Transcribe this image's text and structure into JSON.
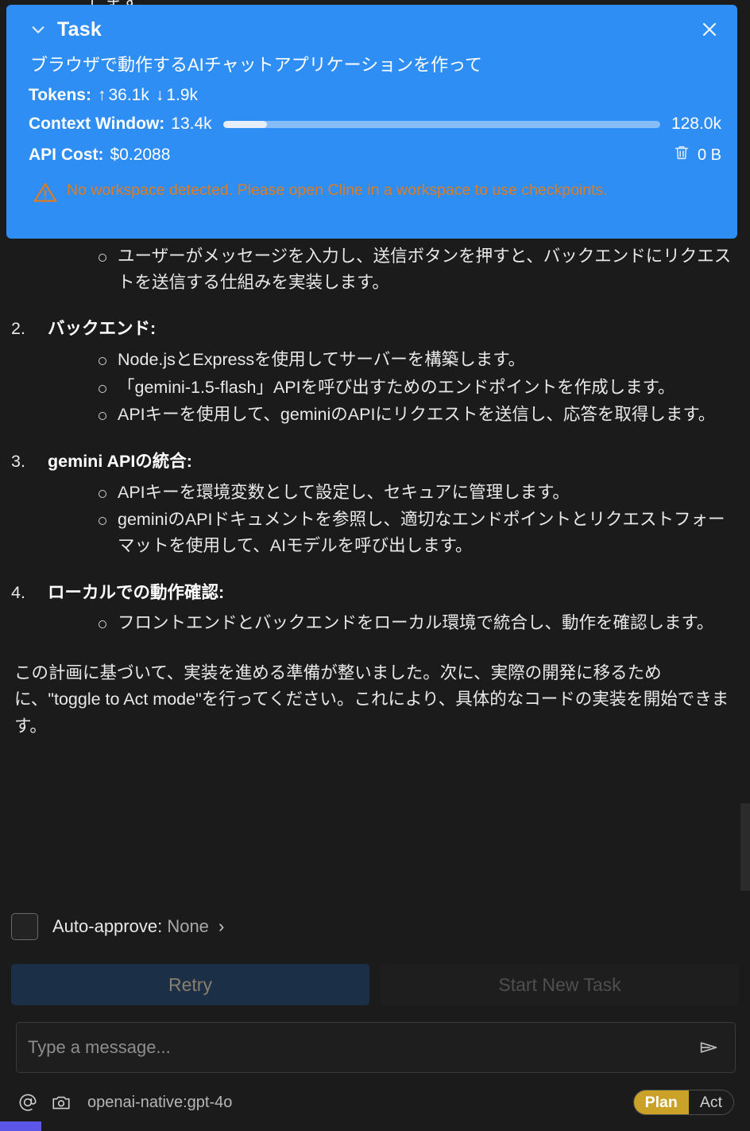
{
  "task_panel": {
    "title": "Task",
    "collapse_icon": "chevron-down-icon",
    "close_icon": "close-icon",
    "description": "ブラウザで動作するAIチャットアプリケーションを作って",
    "tokens_label": "Tokens:",
    "tokens_up_arrow": "↑",
    "tokens_up": "36.1k",
    "tokens_down_arrow": "↓",
    "tokens_down": "1.9k",
    "context_label": "Context Window:",
    "context_used": "13.4k",
    "context_max": "128.0k",
    "context_fill_percent": 10,
    "cost_label": "API Cost:",
    "cost_value": "$0.2088",
    "delete_icon": "trash-icon",
    "size_value": "0 B",
    "warning_icon": "warning-triangle-icon",
    "warning_text": "No workspace detected. Please open Cline in a workspace to use checkpoints.",
    "accent_bg": "#2f8ef4",
    "warning_color": "#de7c22"
  },
  "conversation": {
    "clipped_line": "します。",
    "items": [
      {
        "type": "bullet",
        "text": "ユーザーがメッセージを入力し、送信ボタンを押すと、バックエンドにリクエストを送信する仕組みを実装します。"
      },
      {
        "type": "numbered",
        "number": "2.",
        "heading": "バックエンド:",
        "bullets": [
          "Node.jsとExpressを使用してサーバーを構築します。",
          "「gemini-1.5-flash」APIを呼び出すためのエンドポイントを作成します。",
          "APIキーを使用して、geminiのAPIにリクエストを送信し、応答を取得します。"
        ]
      },
      {
        "type": "numbered",
        "number": "3.",
        "heading": "gemini APIの統合:",
        "bullets": [
          "APIキーを環境変数として設定し、セキュアに管理します。",
          "geminiのAPIドキュメントを参照し、適切なエンドポイントとリクエストフォーマットを使用して、AIモデルを呼び出します。"
        ]
      },
      {
        "type": "numbered",
        "number": "4.",
        "heading": "ローカルでの動作確認:",
        "bullets": [
          "フロントエンドとバックエンドをローカル環境で統合し、動作を確認します。"
        ]
      }
    ],
    "closing_paragraph": "この計画に基づいて、実装を進める準備が整いました。次に、実際の開発に移るために、\"toggle to Act mode\"を行ってください。これにより、具体的なコードの実装を開始できます。"
  },
  "auto_approve": {
    "label": "Auto-approve:",
    "value": "None",
    "chevron": "›",
    "checked": false
  },
  "buttons": {
    "retry": "Retry",
    "start_new_task": "Start New Task",
    "retry_bg": "#1b3047"
  },
  "message_input": {
    "placeholder": "Type a message...",
    "value": "",
    "send_icon": "send-icon"
  },
  "bottom_bar": {
    "mention_icon": "at-sign-icon",
    "camera_icon": "camera-icon",
    "model": "openai-native:gpt-4o",
    "mode_plan": "Plan",
    "mode_act": "Act",
    "active_mode": "Plan",
    "plan_color": "#c9a227"
  }
}
